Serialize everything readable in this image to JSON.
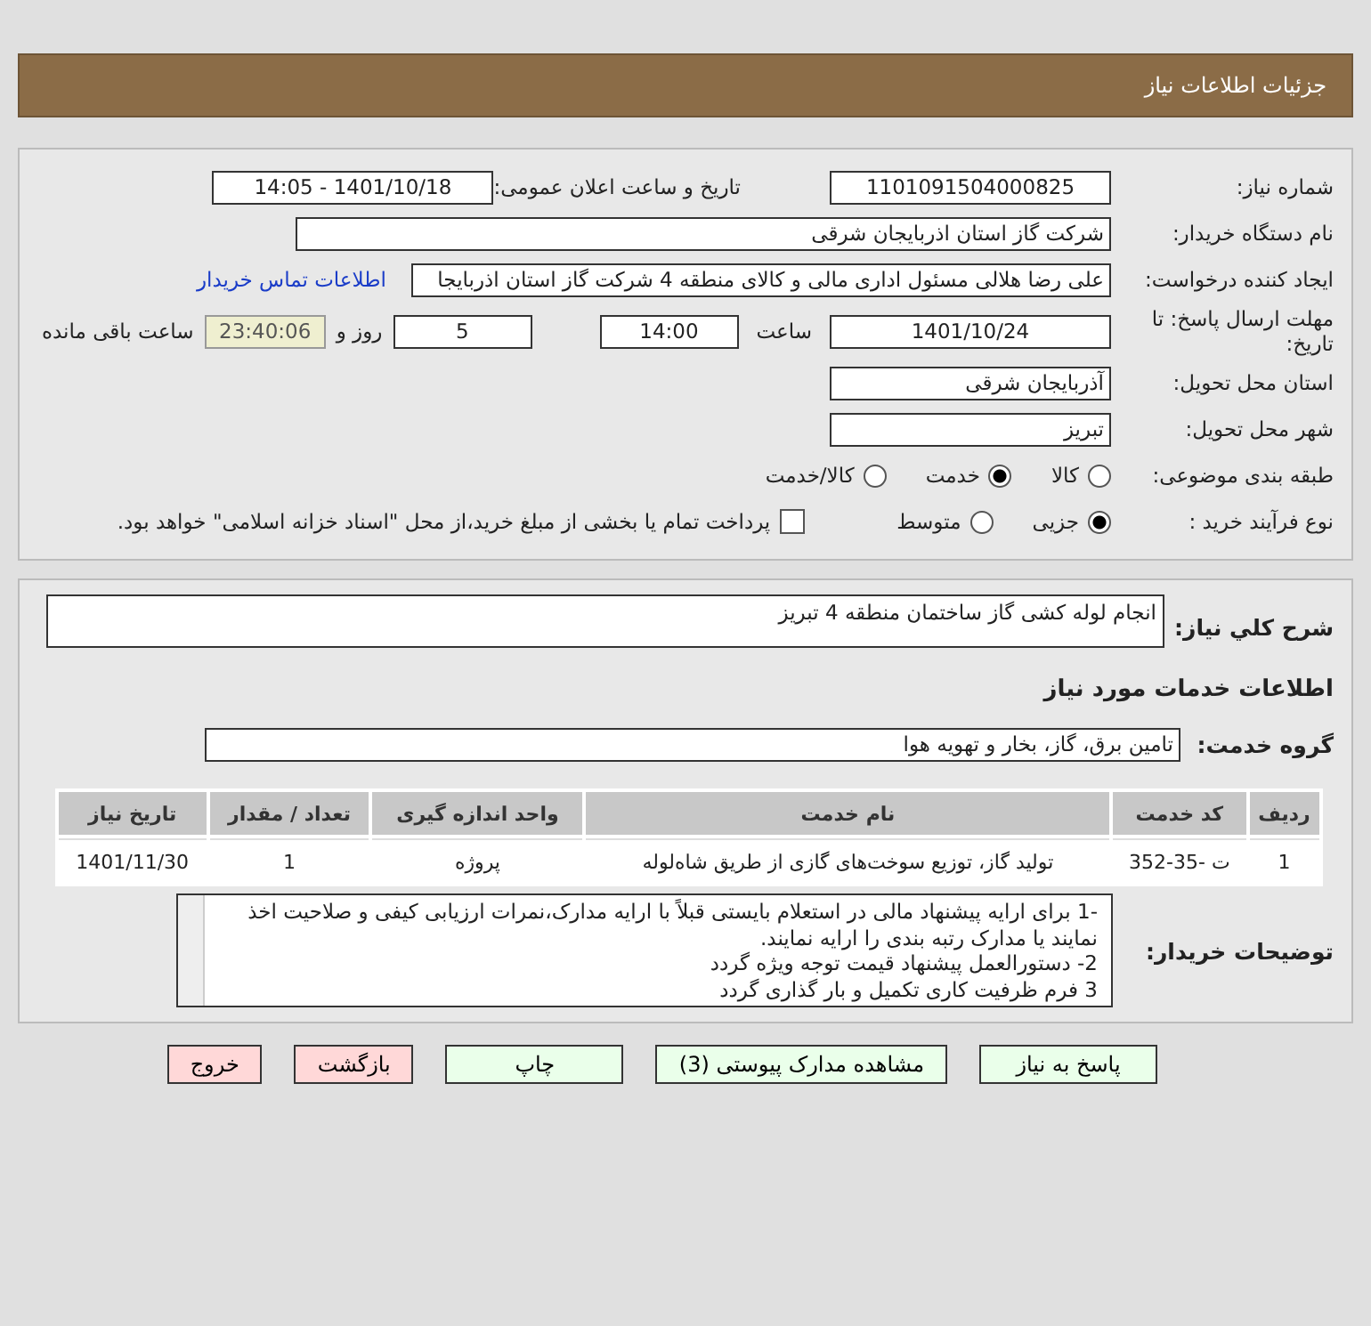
{
  "header": {
    "title": "جزئیات اطلاعات نیاز"
  },
  "fields": {
    "need_number": {
      "label": "شماره نیاز:",
      "value": "1101091504000825"
    },
    "announce_datetime": {
      "label": "تاریخ و ساعت اعلان عمومی:",
      "value": "1401/10/18 - 14:05"
    },
    "buyer_org": {
      "label": "نام دستگاه خریدار:",
      "value": "شرکت گاز استان اذربایجان شرقی"
    },
    "requester": {
      "label": "ایجاد کننده درخواست:",
      "value": "علی رضا هلالی مسئول اداری مالی و کالای منطقه 4 شرکت گاز استان اذربایجا",
      "link": "اطلاعات تماس خریدار"
    },
    "deadline": {
      "label": "مهلت ارسال پاسخ: تا تاریخ:",
      "date": "1401/10/24",
      "time_label": "ساعت",
      "time": "14:00",
      "days": "5",
      "days_label": "روز و",
      "remaining": "23:40:06",
      "remaining_label": "ساعت باقی مانده"
    },
    "province": {
      "label": "استان محل تحویل:",
      "value": "آذربایجان شرقی"
    },
    "city": {
      "label": "شهر محل تحویل:",
      "value": "تبریز"
    },
    "category": {
      "label": "طبقه بندی موضوعی:",
      "options": [
        {
          "label": "کالا",
          "selected": false
        },
        {
          "label": "خدمت",
          "selected": true
        },
        {
          "label": "کالا/خدمت",
          "selected": false
        }
      ]
    },
    "purchase_type": {
      "label": "نوع فرآیند خرید :",
      "options": [
        {
          "label": "جزیی",
          "selected": true
        },
        {
          "label": "متوسط",
          "selected": false
        }
      ],
      "payment_note": {
        "label": "پرداخت تمام یا بخشی از مبلغ خرید،از محل \"اسناد خزانه اسلامی\" خواهد بود.",
        "checked": false
      }
    }
  },
  "summary": {
    "label": "شرح کلي نياز:",
    "value": "انجام لوله کشی گاز ساختمان منطقه 4 تبریز"
  },
  "services_title": "اطلاعات خدمات مورد نیاز",
  "service_group": {
    "label": "گروه خدمت:",
    "value": "تامین برق، گاز، بخار و تهویه هوا"
  },
  "table": {
    "columns": [
      "ردیف",
      "کد خدمت",
      "نام خدمت",
      "واحد اندازه گیری",
      "تعداد / مقدار",
      "تاریخ نیاز"
    ],
    "rows": [
      [
        "1",
        "ت -35-352",
        "تولید گاز، توزیع سوخت‌های گازی از طریق شاه‌لوله",
        "پروژه",
        "1",
        "1401/11/30"
      ]
    ]
  },
  "buyer_notes": {
    "label": "توضیحات خریدار:",
    "lines": [
      "-1 برای ارایه پیشنهاد مالی در استعلام بایستی قبلاً با ارایه مدارک،نمرات ارزیابی کیفی و صلاحیت اخذ نمایند یا مدارک رتبه بندی را ارایه نمایند.",
      "2- دستورالعمل پیشنهاد قیمت توجه ویژه گردد",
      "3 فرم ظرفیت کاری تکمیل و بار گذاری گردد"
    ]
  },
  "buttons": [
    {
      "label": "پاسخ به نیاز",
      "kind": "action"
    },
    {
      "label": "مشاهده مدارک پیوستی (3)",
      "kind": "action"
    },
    {
      "label": "چاپ",
      "kind": "action"
    },
    {
      "label": "بازگشت",
      "kind": "exit"
    },
    {
      "label": "خروج",
      "kind": "exit"
    }
  ]
}
